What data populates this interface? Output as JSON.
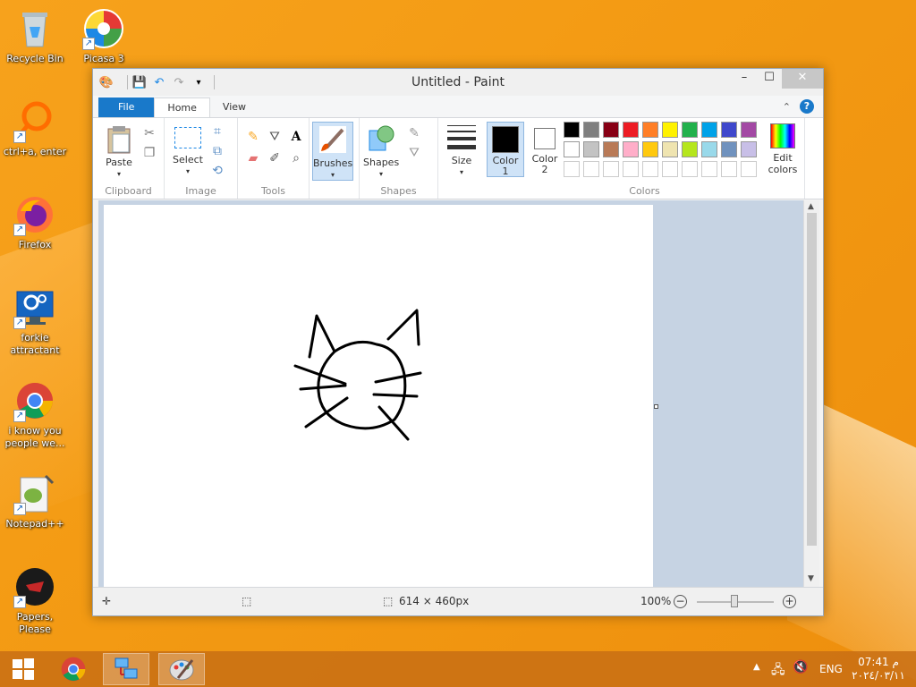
{
  "desktop": {
    "icons": [
      {
        "label": "Recycle Bin"
      },
      {
        "label": "Picasa 3"
      },
      {
        "label": "ctrl+a, enter"
      },
      {
        "label": "Firefox"
      },
      {
        "label": "forkie attractant"
      },
      {
        "label": "i know you people we..."
      },
      {
        "label": "Notepad++"
      },
      {
        "label": "Papers, Please"
      }
    ]
  },
  "window": {
    "title": "Untitled - Paint",
    "controls": {
      "minimize": "–",
      "maximize": "☐",
      "close": "✕"
    }
  },
  "tabs": {
    "file": "File",
    "home": "Home",
    "view": "View"
  },
  "ribbon": {
    "clipboard": {
      "paste": "Paste",
      "label": "Clipboard"
    },
    "image": {
      "select": "Select",
      "label": "Image"
    },
    "tools": {
      "label": "Tools"
    },
    "brushes": {
      "label": "Brushes"
    },
    "shapes": {
      "button": "Shapes",
      "label": "Shapes"
    },
    "size": {
      "label": "Size"
    },
    "colors": {
      "color1": "Color\n1",
      "color2": "Color\n2",
      "edit": "Edit colors",
      "label": "Colors",
      "color1_value": "#000000",
      "color2_value": "#ffffff",
      "palette_row1": [
        "#000000",
        "#7f7f7f",
        "#880015",
        "#ed1c24",
        "#ff7f27",
        "#fff200",
        "#22b14c",
        "#00a2e8",
        "#3f48cc",
        "#a349a4"
      ],
      "palette_row2": [
        "#ffffff",
        "#c3c3c3",
        "#b97a57",
        "#ffaec9",
        "#ffc90e",
        "#efe4b0",
        "#b5e61d",
        "#99d9ea",
        "#7092be",
        "#c8bfe7"
      ]
    }
  },
  "status": {
    "dimensions": "614 × 460px",
    "zoom": "100%"
  },
  "taskbar": {
    "lang": "ENG",
    "time": "07:41 م",
    "date": "٢٠٢٤/٠٣/١١"
  }
}
